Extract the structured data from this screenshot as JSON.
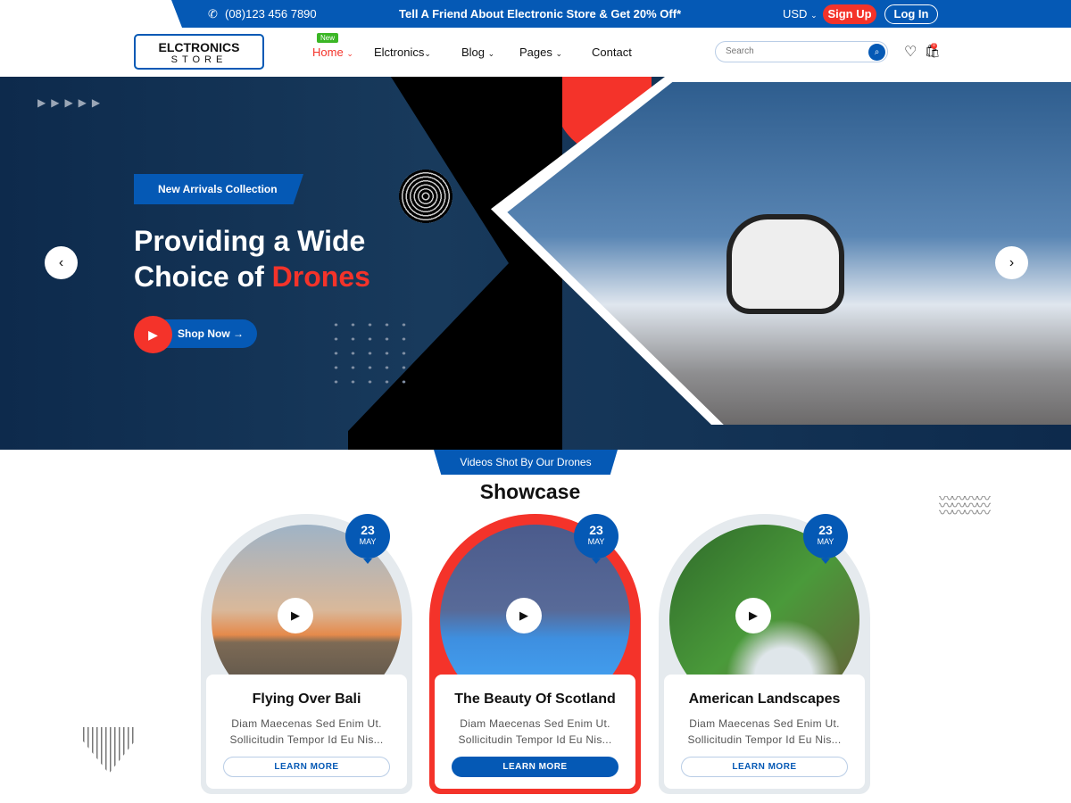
{
  "topbar": {
    "phone": "(08)123 456 7890",
    "promo": "Tell A Friend About Electronic Store & Get 20% Off*",
    "currency": "USD",
    "signup": "Sign Up",
    "login": "Log In"
  },
  "logo": {
    "line1": "ELCTRONICS",
    "line2": "STORE"
  },
  "nav": {
    "badge": "New",
    "items": [
      "Home",
      "Elctronics",
      "Blog",
      "Pages",
      "Contact"
    ]
  },
  "search": {
    "placeholder": "Search"
  },
  "cart": {
    "count": "0"
  },
  "hero": {
    "tag": "New Arrivals Collection",
    "title_line1": "Providing a Wide",
    "title_line2": "Choice of ",
    "title_highlight": "Drones",
    "cta": "Shop Now"
  },
  "showcase": {
    "tag": "Videos Shot By Our Drones",
    "title": "Showcase",
    "cards": [
      {
        "day": "23",
        "month": "MAY",
        "title": "Flying Over Bali",
        "desc1": "Diam Maecenas Sed Enim Ut.",
        "desc2": "Sollicitudin Tempor Id Eu Nis...",
        "button": "LEARN MORE"
      },
      {
        "day": "23",
        "month": "MAY",
        "title": "The Beauty Of Scotland",
        "desc1": "Diam Maecenas Sed Enim Ut.",
        "desc2": "Sollicitudin Tempor Id Eu Nis...",
        "button": "LEARN MORE"
      },
      {
        "day": "23",
        "month": "MAY",
        "title": "American Landscapes",
        "desc1": "Diam Maecenas Sed Enim Ut.",
        "desc2": "Sollicitudin Tempor Id Eu Nis...",
        "button": "LEARN MORE"
      }
    ]
  },
  "colors": {
    "primary": "#0559b5",
    "accent": "#f4332a",
    "badge": "#3bb625"
  }
}
